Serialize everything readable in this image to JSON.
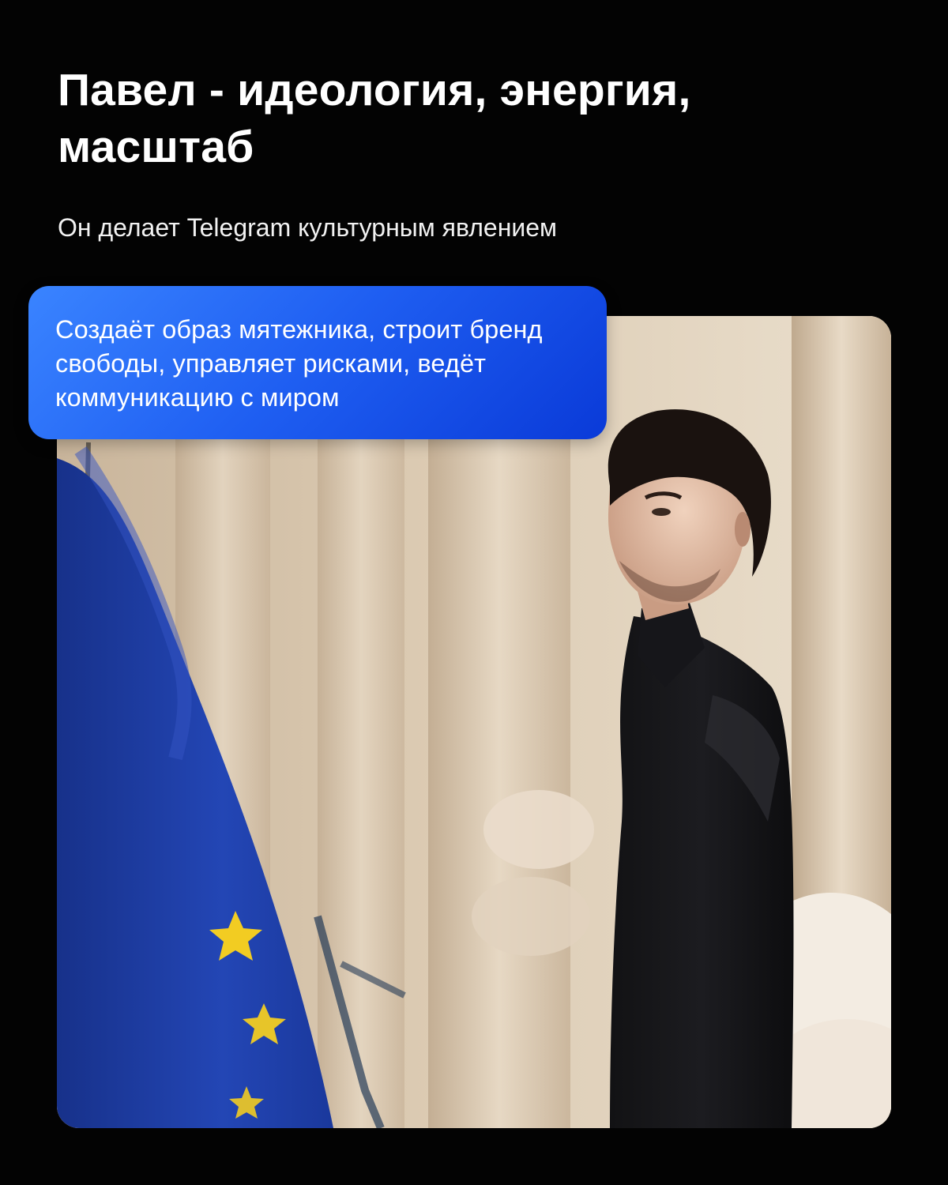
{
  "header": {
    "title": "Павел - идеология, энергия, масштаб",
    "subtitle": "Он делает Telegram культурным явлением"
  },
  "callout": {
    "text": "Создаёт образ мятежника, строит бренд свободы, управляет рисками, ведёт коммуникацию с миром"
  },
  "photo": {
    "subject": "portrait-man-with-eu-flag"
  },
  "colors": {
    "background": "#030303",
    "callout_start": "#3a84ff",
    "callout_end": "#0a3ad8",
    "flag_blue": "#1d3fa8",
    "flag_star": "#f2cc22"
  }
}
